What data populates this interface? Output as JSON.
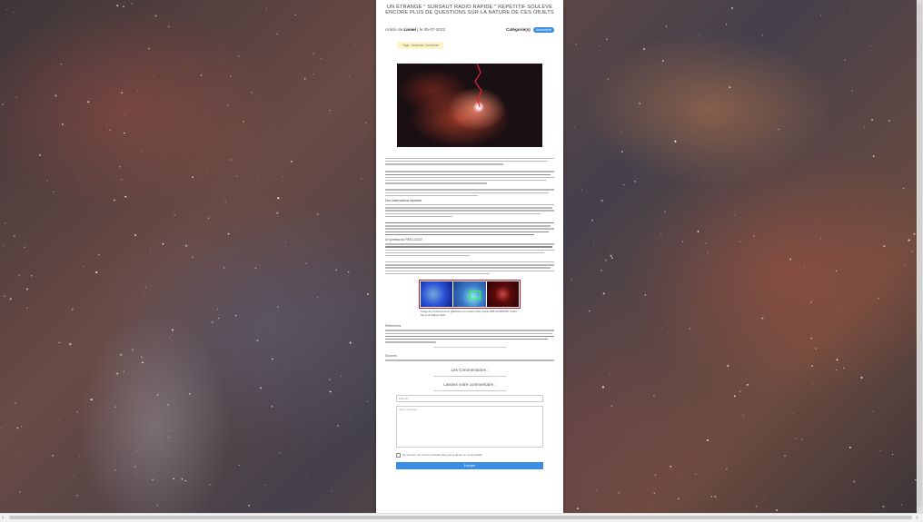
{
  "article": {
    "title": "UN ÉTRANGE \" SURSAUT RADIO RAPIDE \" RÉPÉTITIF SOULÈVE ENCORE PLUS DE QUESTIONS SUR LA NATURE DE CES OBJETS",
    "author_prefix": "Article de",
    "author": "Lionel",
    "date_text": "| le 05-07-2022",
    "category_label": "Catégorie(s)",
    "category_badge": "Astronomie",
    "tag_text": "Tags : #science, #universe",
    "section_label_1": "Des observations répétées",
    "section_label_2": "Un jumeau du FRB 121102",
    "figure_caption": "Image de l'environnement galactique du sursaut radio rapide FRB 20190520B. Crédit : Niu et al./Nature 2022",
    "section_label_3": "Références",
    "sources_label": "Sources :"
  },
  "comments": {
    "heading": "Les Commentaires :",
    "leave_heading": "Laissez votre commentaire :",
    "name_placeholder": "Pseudo",
    "message_placeholder": "Votre message",
    "checkbox_label": "Se souvenir de moi la prochaine fois que je laisse un commentaire",
    "submit_label": "Envoyer"
  },
  "colors": {
    "accent": "#3a8de0",
    "figure_border": "#c0182a",
    "tag_bg": "#fdf5c8"
  }
}
